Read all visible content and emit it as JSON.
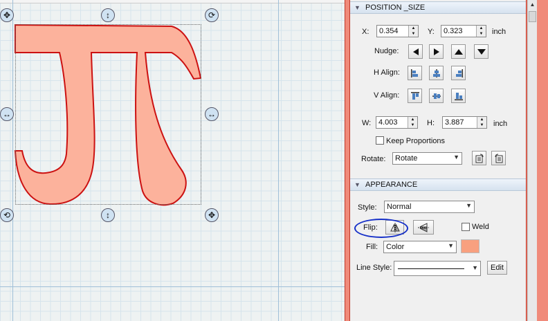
{
  "colors": {
    "shape_fill": "#fcb29c",
    "shape_stroke": "#cc1111",
    "fill_swatch": "#f8a07f",
    "annotation": "#1630c8",
    "accent_border": "#f08a7a"
  },
  "canvas": {
    "shape_name": "pi-symbol",
    "handles": {
      "top_left": "move-icon",
      "top_center": "resize-vertical-icon",
      "top_right": "rotate-icon",
      "mid_left": "resize-horizontal-icon",
      "mid_right": "resize-horizontal-icon",
      "bottom_left": "rotate-icon",
      "bottom_center": "resize-vertical-icon",
      "bottom_right": "move-icon"
    }
  },
  "position_size": {
    "title": "POSITION _SIZE",
    "x_label": "X:",
    "x_value": "0.354",
    "y_label": "Y:",
    "y_value": "0.323",
    "pos_unit": "inch",
    "nudge_label": "Nudge:",
    "nudge_icons": [
      "arrow-left-icon",
      "arrow-right-icon",
      "arrow-up-icon",
      "arrow-down-icon"
    ],
    "halign_label": "H Align:",
    "valign_label": "V Align:",
    "w_label": "W:",
    "w_value": "4.003",
    "h_label": "H:",
    "h_value": "3.887",
    "size_unit": "inch",
    "keep_proportions": "Keep Proportions",
    "rotate_label": "Rotate:",
    "rotate_value": "Rotate"
  },
  "appearance": {
    "title": "APPEARANCE",
    "style_label": "Style:",
    "style_value": "Normal",
    "flip_label": "Flip:",
    "weld_label": "Weld",
    "fill_label": "Fill:",
    "fill_value": "Color",
    "line_style_label": "Line Style:",
    "edit_label": "Edit"
  }
}
